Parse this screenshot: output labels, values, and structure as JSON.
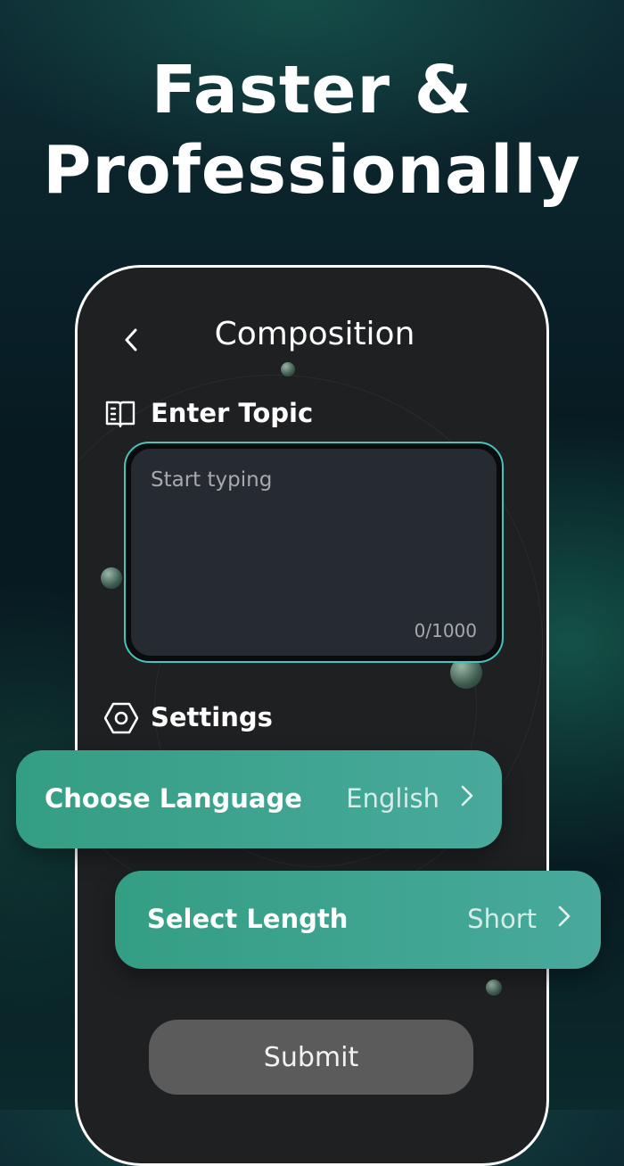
{
  "headline": {
    "line1": "Faster &",
    "line2": "Professionally"
  },
  "screen": {
    "title": "Composition",
    "back_icon": "chevron-left-icon"
  },
  "topic": {
    "label": "Enter Topic",
    "icon": "book-icon",
    "placeholder": "Start typing",
    "counter": "0/1000"
  },
  "settings": {
    "label": "Settings",
    "icon": "hexagon-settings-icon",
    "language": {
      "label": "Choose Language",
      "value": "English"
    },
    "length": {
      "label": "Select Length",
      "value": "Short"
    }
  },
  "submit_label": "Submit",
  "colors": {
    "accent": "#43c4bd",
    "option_bg": "#3da590",
    "submit_bg": "#5b5b5b",
    "phone_bg": "#1f2022"
  }
}
